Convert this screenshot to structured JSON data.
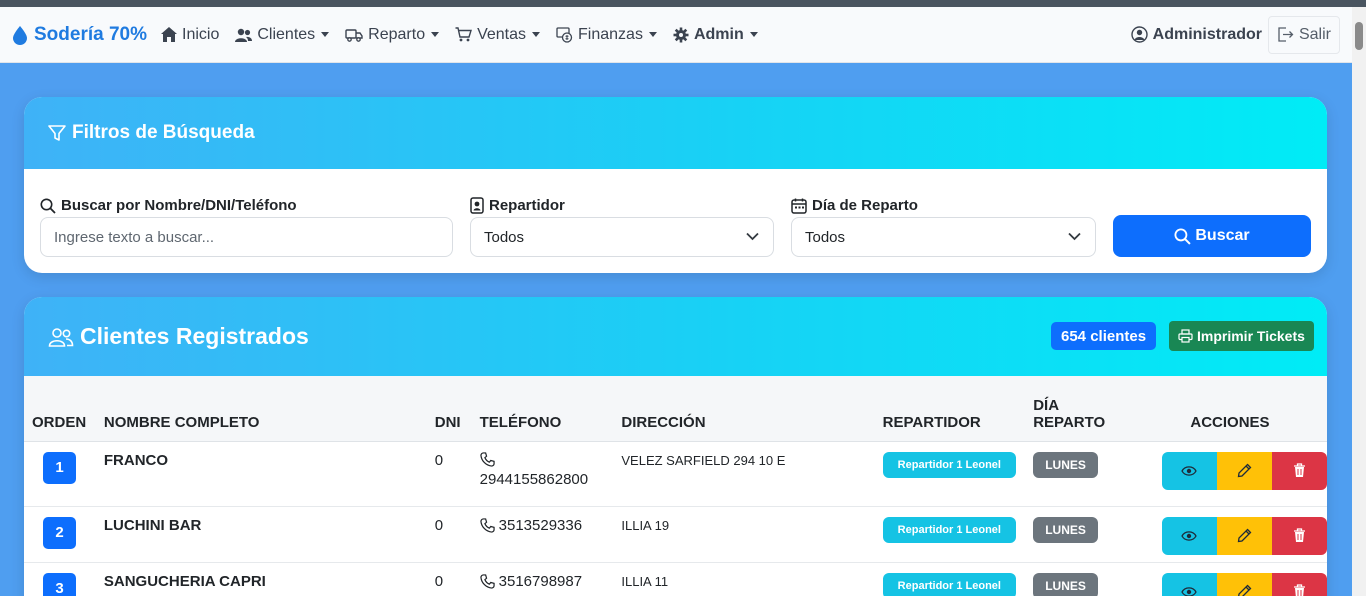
{
  "navbar": {
    "brand": "Sodería 70%",
    "items": [
      {
        "label": "Inicio",
        "icon": "home-icon",
        "dropdown": false
      },
      {
        "label": "Clientes",
        "icon": "users-icon",
        "dropdown": true
      },
      {
        "label": "Reparto",
        "icon": "truck-icon",
        "dropdown": true
      },
      {
        "label": "Ventas",
        "icon": "cart-icon",
        "dropdown": true
      },
      {
        "label": "Finanzas",
        "icon": "cash-icon",
        "dropdown": true
      },
      {
        "label": "Admin",
        "icon": "gear-icon",
        "dropdown": true
      }
    ],
    "user": "Administrador",
    "logout": "Salir"
  },
  "filters": {
    "title": "Filtros de Búsqueda",
    "search_label": "Buscar por Nombre/DNI/Teléfono",
    "search_placeholder": "Ingrese texto a buscar...",
    "repartidor_label": "Repartidor",
    "repartidor_value": "Todos",
    "dia_label": "Día de Reparto",
    "dia_value": "Todos",
    "search_button": "Buscar"
  },
  "clients": {
    "title": "Clientes Registrados",
    "count": "654 clientes",
    "print_button": "Imprimir Tickets",
    "headers": {
      "orden": "ORDEN",
      "nombre": "NOMBRE COMPLETO",
      "dni": "DNI",
      "telefono": "TELÉFONO",
      "direccion": "DIRECCIÓN",
      "repartidor": "REPARTIDOR",
      "dia_l1": "DÍA",
      "dia_l2": "REPARTO",
      "acciones": "ACCIONES"
    },
    "rows": [
      {
        "orden": "1",
        "nombre": "FRANCO",
        "dni": "0",
        "telefono": "2944155862800",
        "direccion": "VELEZ SARFIELD 294 10 E",
        "repartidor": "Repartidor 1 Leonel",
        "dia": "LUNES"
      },
      {
        "orden": "2",
        "nombre": "LUCHINI BAR",
        "dni": "0",
        "telefono": "3513529336",
        "direccion": "ILLIA 19",
        "repartidor": "Repartidor 1 Leonel",
        "dia": "LUNES"
      },
      {
        "orden": "3",
        "nombre": "SANGUCHERIA CAPRI",
        "dni": "0",
        "telefono": "3516798987",
        "direccion": "ILLIA 11",
        "repartidor": "Repartidor 1 Leonel",
        "dia": "LUNES"
      }
    ]
  },
  "colors": {
    "background": "#4f9ef0",
    "primary": "#0d6efd",
    "info": "#15c3e4",
    "warning": "#ffc107",
    "danger": "#dc3545",
    "success": "#198754",
    "secondary": "#6c757d"
  }
}
